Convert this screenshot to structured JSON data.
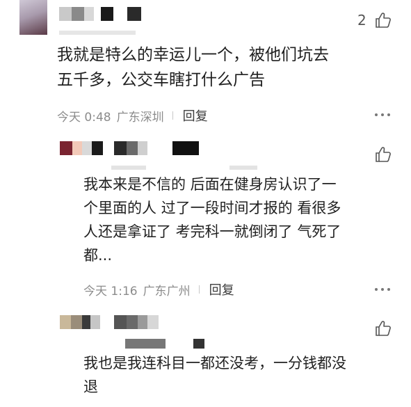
{
  "comments": [
    {
      "like_count": "2",
      "text_lines": [
        "我就是特么的幸运儿一个，被他们坑去",
        "五千多，公交车瞎打什么广告"
      ],
      "time": "今天 0:48",
      "location": "广东深圳",
      "reply_label": "回复",
      "like_icon": "thumbs-up-icon",
      "more_icon": "more-dots-icon"
    }
  ],
  "replies": [
    {
      "text_lines": [
        "我本来是不信的 后面在健身房认识了一",
        "个里面的人 过了一段时间才报的 看很多",
        "人还是拿证了 考完科一就倒闭了 气死了",
        "都..."
      ],
      "time": "今天 1:16",
      "location": "广东广州",
      "reply_label": "回复",
      "like_icon": "thumbs-up-icon",
      "more_icon": "more-dots-icon"
    },
    {
      "text_lines": [
        "我也是我连科目一都还没考，一分钱都没",
        "退"
      ],
      "like_icon": "thumbs-up-icon"
    }
  ],
  "colors": {
    "text": "#1f1f1f",
    "meta": "#8c8c8c",
    "icon": "#555555"
  }
}
